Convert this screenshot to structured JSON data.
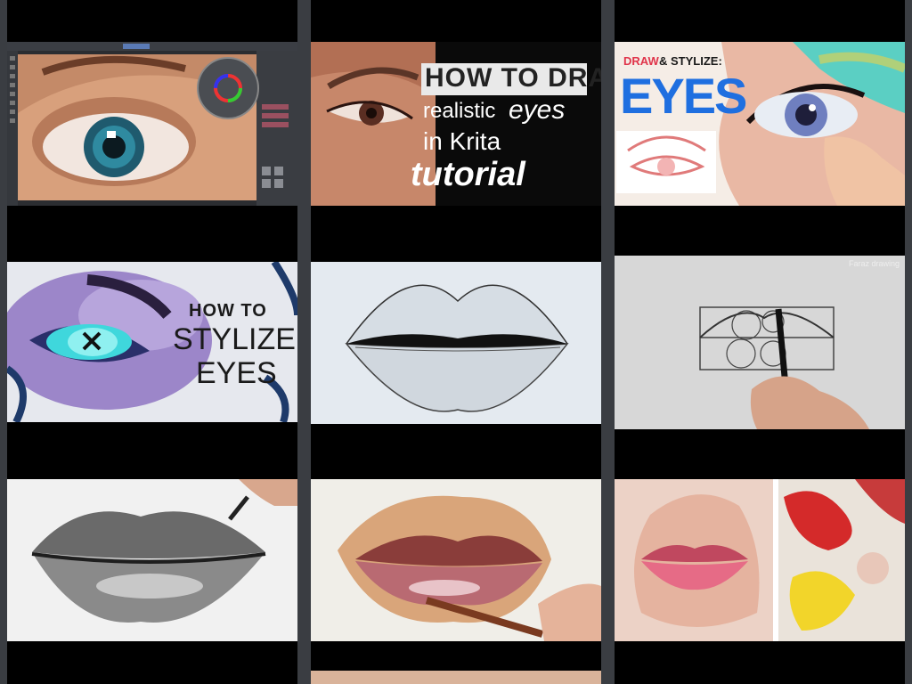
{
  "grid": {
    "columns": 3,
    "thumbnails": [
      {
        "id": "krita-eye-ui",
        "alt": "Digital eye painting in Krita interface",
        "text": []
      },
      {
        "id": "krita-realistic-eyes",
        "alt": "How to draw realistic eyes in Krita tutorial",
        "text": [
          "HOW TO DRAW",
          "realistic",
          "eyes",
          "in Krita",
          "tutorial"
        ]
      },
      {
        "id": "draw-stylize-eyes",
        "alt": "Draw and stylize eyes",
        "text": [
          "DRAW",
          "& STYLIZE:",
          "EYES"
        ]
      },
      {
        "id": "how-to-stylize-eyes",
        "alt": "How to stylize eyes",
        "text": [
          "HOW TO",
          "STYLIZE",
          "EYES"
        ]
      },
      {
        "id": "pencil-lips-sketch",
        "alt": "Pencil sketch of lips",
        "text": []
      },
      {
        "id": "faraz-lips-construction",
        "alt": "Lips construction drawing",
        "text": [
          "Faraz drawing"
        ]
      },
      {
        "id": "graphite-lips",
        "alt": "Realistic graphite lips drawing",
        "text": []
      },
      {
        "id": "oil-paint-lips",
        "alt": "Oil painting of lips",
        "text": []
      },
      {
        "id": "paint-lips-palette",
        "alt": "Painted pink lips with palette",
        "text": []
      }
    ]
  },
  "colors": {
    "background": "#3a3d42",
    "column": "#000000",
    "blue_title": "#1f6fe0",
    "red_title": "#e0344a"
  }
}
